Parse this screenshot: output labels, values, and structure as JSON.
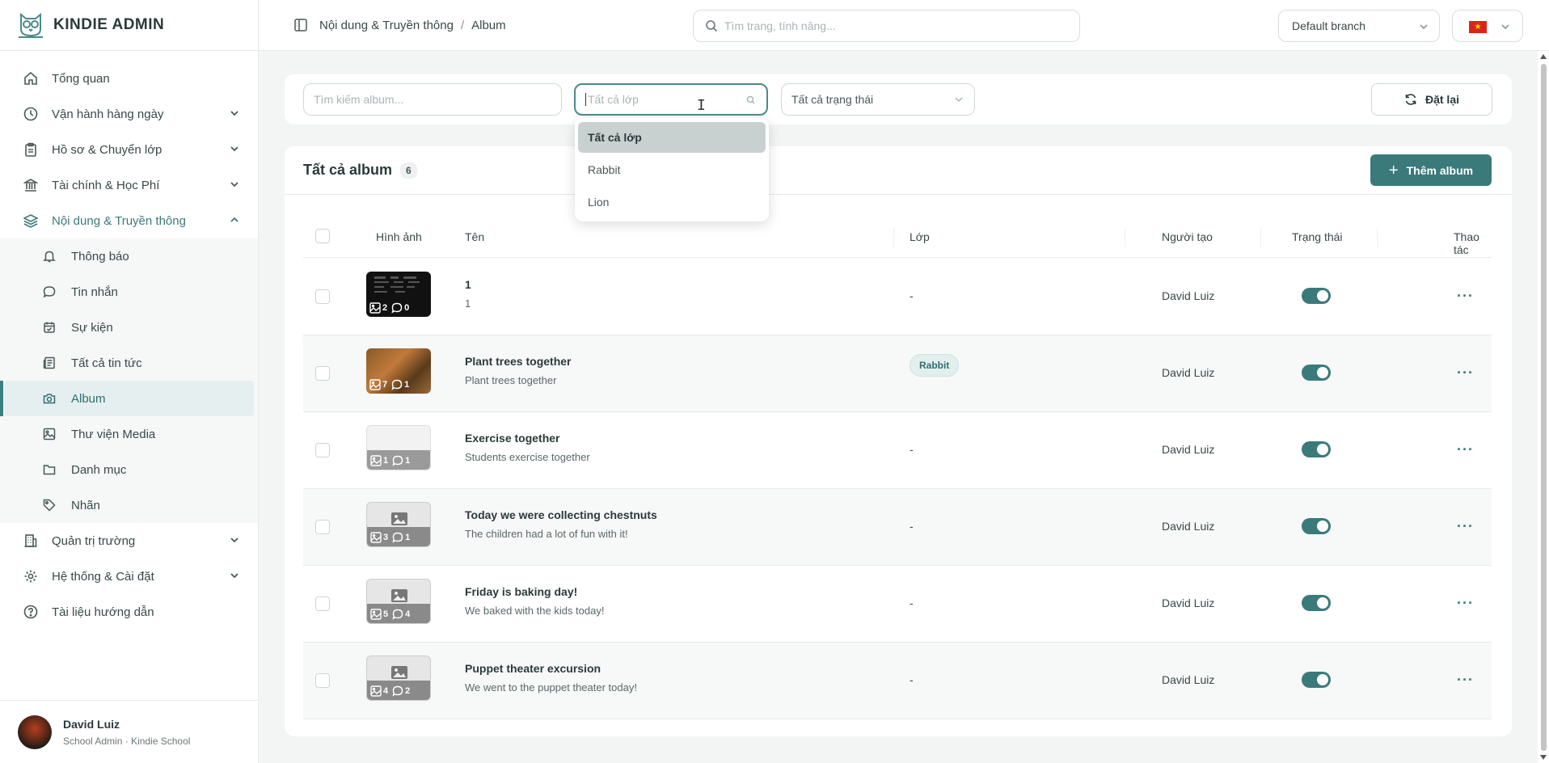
{
  "brand": {
    "name": "KINDIE ADMIN"
  },
  "sidebar": {
    "items": [
      {
        "label": "Tổng quan",
        "icon": "home-icon"
      },
      {
        "label": "Vận hành hàng ngày",
        "icon": "clock-icon"
      },
      {
        "label": "Hồ sơ & Chuyển lớp",
        "icon": "clipboard-icon"
      },
      {
        "label": "Tài chính & Học Phí",
        "icon": "bank-icon"
      },
      {
        "label": "Nội dung & Truyền thông",
        "icon": "layers-icon"
      },
      {
        "label": "Quản trị trường",
        "icon": "building-icon"
      },
      {
        "label": "Hệ thống & Cài đặt",
        "icon": "gear-icon"
      },
      {
        "label": "Tài liệu hướng dẫn",
        "icon": "help-icon"
      }
    ],
    "subitems": [
      {
        "label": "Thông báo",
        "icon": "bell-icon"
      },
      {
        "label": "Tin nhắn",
        "icon": "chat-icon"
      },
      {
        "label": "Sự kiện",
        "icon": "calendar-icon"
      },
      {
        "label": "Tất cả tin tức",
        "icon": "newspaper-icon"
      },
      {
        "label": "Album",
        "icon": "camera-icon"
      },
      {
        "label": "Thư viện Media",
        "icon": "image-icon"
      },
      {
        "label": "Danh mục",
        "icon": "folder-icon"
      },
      {
        "label": "Nhãn",
        "icon": "tag-icon"
      }
    ],
    "user": {
      "name": "David Luiz",
      "role": "School Admin · Kindie School"
    }
  },
  "header": {
    "breadcrumb": [
      "Nội dung & Truyền thông",
      "Album"
    ],
    "search_placeholder": "Tìm trang, tính năng...",
    "branch": "Default branch"
  },
  "filters": {
    "search_placeholder": "Tìm kiếm album...",
    "class_placeholder": "Tất cả lớp",
    "status_placeholder": "Tất cả trạng thái",
    "reset_label": "Đặt lại",
    "class_options": [
      "Tất cả lớp",
      "Rabbit",
      "Lion"
    ]
  },
  "albums": {
    "title": "Tất cả album",
    "count": "6",
    "add_label": "Thêm album",
    "columns": [
      "Hình ảnh",
      "Tên",
      "Lớp",
      "Người tạo",
      "Trạng thái",
      "Thao tác"
    ],
    "rows": [
      {
        "name": "1",
        "desc": "1",
        "cls": "-",
        "creator": "David Luiz",
        "images": "2",
        "comments": "0"
      },
      {
        "name": "Plant trees together",
        "desc": "Plant trees together",
        "cls": "Rabbit",
        "creator": "David Luiz",
        "images": "7",
        "comments": "1"
      },
      {
        "name": "Exercise together",
        "desc": "Students exercise together",
        "cls": "-",
        "creator": "David Luiz",
        "images": "1",
        "comments": "1"
      },
      {
        "name": "Today we were collecting chestnuts",
        "desc": "The children had a lot of fun with it!",
        "cls": "-",
        "creator": "David Luiz",
        "images": "3",
        "comments": "1"
      },
      {
        "name": "Friday is baking day!",
        "desc": "We baked with the kids today!",
        "cls": "-",
        "creator": "David Luiz",
        "images": "5",
        "comments": "4"
      },
      {
        "name": "Puppet theater excursion",
        "desc": "We went to the puppet theater today!",
        "cls": "-",
        "creator": "David Luiz",
        "images": "4",
        "comments": "2"
      }
    ]
  },
  "colors": {
    "accent": "#3b7a7a",
    "accent_light": "#e6eff0"
  }
}
